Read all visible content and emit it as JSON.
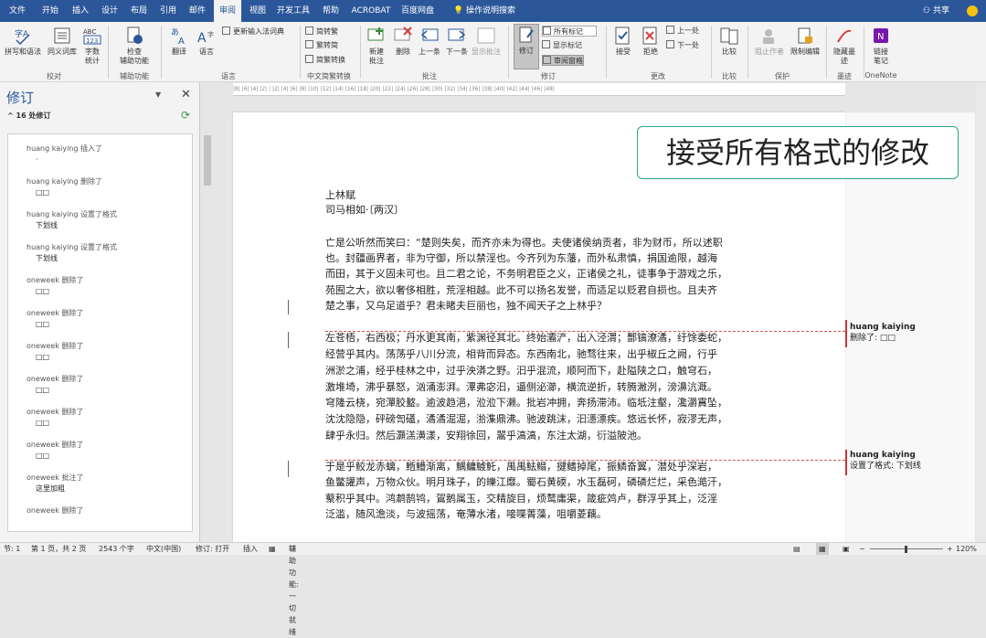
{
  "menu": {
    "tabs": [
      "文件",
      "开始",
      "插入",
      "设计",
      "布局",
      "引用",
      "邮件",
      "审阅",
      "视图",
      "开发工具",
      "帮助",
      "ACROBAT",
      "百度网盘"
    ],
    "search": "操作说明搜索",
    "share": "共享",
    "active": "审阅"
  },
  "ribbon": {
    "btn_spell": "拼写和语法",
    "btn_thesaurus": "同义词库",
    "btn_wordcount_l1": "字数",
    "btn_wordcount_l2": "统计",
    "group_proof": "校对",
    "btn_check_l1": "检查",
    "btn_check_l2": "辅助功能",
    "group_access": "辅助功能",
    "btn_translate": "翻译",
    "btn_language": "语言",
    "btn_update_ime": "更新输入法词典",
    "group_lang": "语言",
    "btn_trad": "简转繁",
    "btn_simp": "繁转简",
    "btn_conv": "简繁转换",
    "group_chinese": "中文简繁转换",
    "btn_new_comment_l1": "新建",
    "btn_new_comment_l2": "批注",
    "btn_delete": "删除",
    "btn_prev": "上一条",
    "btn_next": "下一条",
    "btn_show_comments": "显示批注",
    "group_comments": "批注",
    "btn_track_l1": "修订",
    "btn_all_markup": "所有标记",
    "btn_show_markup": "显示标记",
    "btn_review_pane": "审阅窗格",
    "group_tracking": "修订",
    "btn_accept": "接受",
    "btn_reject": "拒绝",
    "btn_prev_change": "上一处",
    "btn_next_change": "下一处",
    "group_changes": "更改",
    "btn_compare": "比较",
    "group_compare": "比较",
    "btn_block_authors": "阻止作者",
    "btn_restrict": "限制编辑",
    "group_protect": "保护",
    "btn_hide_ink_l1": "隐藏墨",
    "btn_hide_ink_l2": "迹",
    "group_ink": "墨迹",
    "btn_link_notes_l1": "链接",
    "btn_link_notes_l2": "笔记",
    "group_onenote": "OneNote"
  },
  "pane": {
    "title": "修订",
    "count": "16 处修订",
    "items": [
      {
        "h": "huang kaiying 插入了",
        "d": "·"
      },
      {
        "h": "huang kaiying 删除了",
        "d": "□□"
      },
      {
        "h": "huang kaiying 设置了格式",
        "d": "下划线"
      },
      {
        "h": "huang kaiying 设置了格式",
        "d": "下划线"
      },
      {
        "h": "oneweek 删除了",
        "d": "□□"
      },
      {
        "h": "oneweek 删除了",
        "d": "□□"
      },
      {
        "h": "oneweek 删除了",
        "d": "□□"
      },
      {
        "h": "oneweek 删除了",
        "d": "□□"
      },
      {
        "h": "oneweek 删除了",
        "d": "□□"
      },
      {
        "h": "oneweek 删除了",
        "d": "□□"
      },
      {
        "h": "oneweek 批注了",
        "d": "这里加粗"
      },
      {
        "h": "oneweek 删除了",
        "d": ""
      }
    ]
  },
  "ruler": "|8| |6| |4| |2| | |2| |4| |6| |8| |10| |12| |14| |16| |18| |20| |22| |24| |26| |28| |30| |32| |34| |36| |38| |40| |42| |44| |46| |48|",
  "callout": "接受所有格式的修改",
  "doc": [
    "上林赋",
    "司马相如·〔两汉〕",
    "",
    "亡是公听然而笑曰：“楚则失矣，而齐亦未为得也。夫使诸侯纳贡者，非为财币，所以述职",
    "也。封疆画界者，非为守御，所以禁淫也。今齐列为东藩，而外私肃慎，捐国逾限，越海",
    "而田，其于义固未可也。且二君之论，不务明君臣之义，正诸侯之礼，徒事争于游戏之乐，",
    "苑囿之大，欲以奢侈相胜，荒淫相越。此不可以扬名发誉，而适足以贬君自损也。且夫齐",
    "楚之事，又乌足道乎？君未睹夫巨丽也，独不闻天子之上林乎？",
    "",
    "左苍梧，右西极；丹水更其南，紫渊径其北。终始灞浐，出入泾渭；酆镐潦潏，纡馀委蛇，",
    "经营乎其内。荡荡乎八川分流，相背而异态。东西南北，驰骛往来，出乎椒丘之阙，行乎",
    "洲淤之浦，经乎桂林之中，过乎泱漭之野。汩乎混流，顺阿而下，赴隘陕之口，触穹石，",
    "激堆埼，沸乎暴怒，汹涌澎湃。滭弗宓汩，逼侧泌瀄，横流逆折，转腾潎洌，滂濞沆溉。",
    "穹隆云桡，宛潬胶盭。逾波趋浥，涖涖下濑。批岩冲拥，奔扬滞沛。临坻注壑，瀺灂霣坠，",
    "沈沈隐隐，砰磅訇礚，潏潏淈淈，湁潗鼎沸。驰波跳沫，汩濦漂疾。悠远长怀，寂漻无声，",
    "肆乎永归。然后灝溔潢漾，安翔徐回，翯乎滈滈，东注太湖，衍溢陂池。",
    "",
    "于是乎鲛龙赤螭，䱭䲛渐离，鰅鳙鰬魠，禺禺魼鳎，揵鳍掉尾，振鳞奋翼，潜处乎深岩，",
    "鱼鳖讙声，万物众伙。明月珠子，的皪江靡。蜀石黄碝，水玉磊砢，磷磷烂烂，采色澔汗，",
    "藂积乎其中。鸿鹔鹄鸨，鴐鹅属玉，交精旋目，烦鹜庸渠，箴疵䴔卢，群浮乎其上，泛淫",
    "泛滥，随风澹淡，与波摇荡，奄薄水渚，唼喋菁藻，咀嚼菱藕。"
  ],
  "comments": [
    {
      "author": "huang kaiying",
      "text": "删除了: □□"
    },
    {
      "author": "huang kaiying",
      "text": "设置了格式: 下划线"
    }
  ],
  "status": {
    "section": "节: 1",
    "page": "第 1 页，共 2 页",
    "words": "2543 个字",
    "lang": "中文(中国)",
    "track": "修订: 打开",
    "insert": "插入",
    "access": "辅助功能: 一切就绪",
    "zoom": "120%"
  },
  "colors": {
    "accent": "#2b579a",
    "callout_border": "#2aa48a",
    "markup": "#d05050"
  }
}
